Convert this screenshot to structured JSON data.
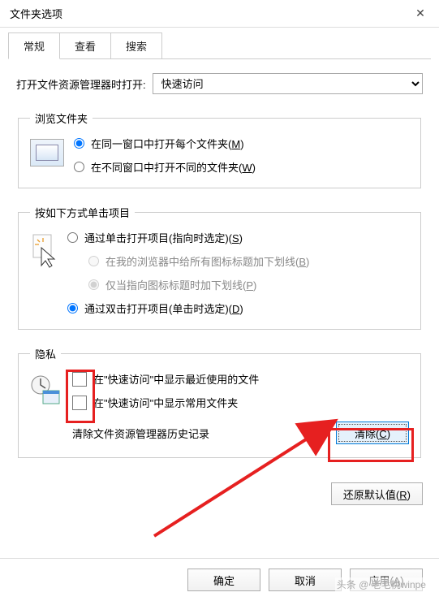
{
  "window": {
    "title": "文件夹选项"
  },
  "tabs": {
    "general": "常规",
    "view": "查看",
    "search": "搜索"
  },
  "open_with": {
    "label": "打开文件资源管理器时打开:",
    "value": "快速访问"
  },
  "browse_folders": {
    "legend": "浏览文件夹",
    "same_window": "在同一窗口中打开每个文件夹(",
    "same_window_key": "M",
    "new_window": "在不同窗口中打开不同的文件夹(",
    "new_window_key": "W",
    "close": ")"
  },
  "click_items": {
    "legend": "按如下方式单击项目",
    "single": "通过单击打开项目(指向时选定)(",
    "single_key": "S",
    "browser_underline": "在我的浏览器中给所有图标标题加下划线(",
    "browser_underline_key": "B",
    "point_underline": "仅当指向图标标题时加下划线(",
    "point_underline_key": "P",
    "double": "通过双击打开项目(单击时选定)(",
    "double_key": "D",
    "close": ")"
  },
  "privacy": {
    "legend": "隐私",
    "recent_files": "在\"快速访问\"中显示最近使用的文件",
    "frequent_folders": "在\"快速访问\"中显示常用文件夹",
    "clear_label": "清除文件资源管理器历史记录",
    "clear_button": "清除(",
    "clear_key": "C",
    "close": ")"
  },
  "restore": {
    "label": "还原默认值(",
    "key": "R",
    "close": ")"
  },
  "footer": {
    "ok": "确定",
    "cancel": "取消",
    "apply": "应用(",
    "apply_key": "A",
    "apply_close": ")"
  },
  "watermark": "头条 @ 老毛桃winpe"
}
